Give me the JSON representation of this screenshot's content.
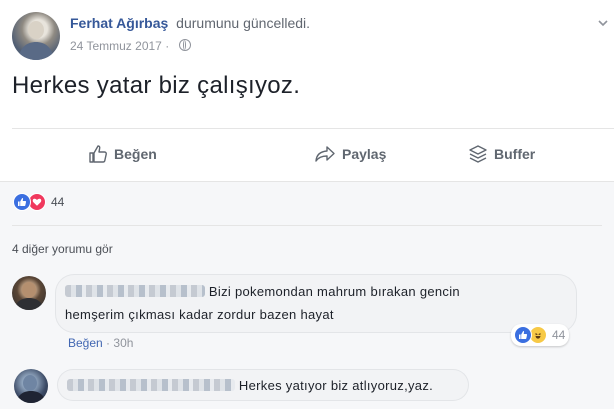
{
  "post": {
    "author": "Ferhat Ağırbaş",
    "action": "durumunu güncelledi.",
    "date": "24 Temmuz 2017",
    "separator": "·",
    "text": "Herkes yatar biz çalışıyoz."
  },
  "actions": {
    "like": "Beğen",
    "share": "Paylaş",
    "buffer": "Buffer"
  },
  "reactions": {
    "count": "44",
    "types": [
      "like-icon",
      "love-icon"
    ],
    "colors": {
      "like": "#3b6fe0",
      "love": "#f0385d",
      "haha": "#f7c946"
    }
  },
  "comments": {
    "more_label": "4 diğer yorumu gör",
    "items": [
      {
        "line1": "Bizi pokemondan mahrum bırakan gencin",
        "line2": "hemşerim çıkması kadar zordur bazen hayat",
        "reaction_count": "44",
        "like_label": "Beğen",
        "time_separator": "·",
        "time": "30h"
      },
      {
        "line1": "Herkes yatıyor biz atlıyoruz,yaz."
      }
    ]
  },
  "colors": {
    "link": "#365899",
    "muted": "#90949c",
    "comment_bg": "#f6f7f9",
    "accent": "#4267b2"
  }
}
